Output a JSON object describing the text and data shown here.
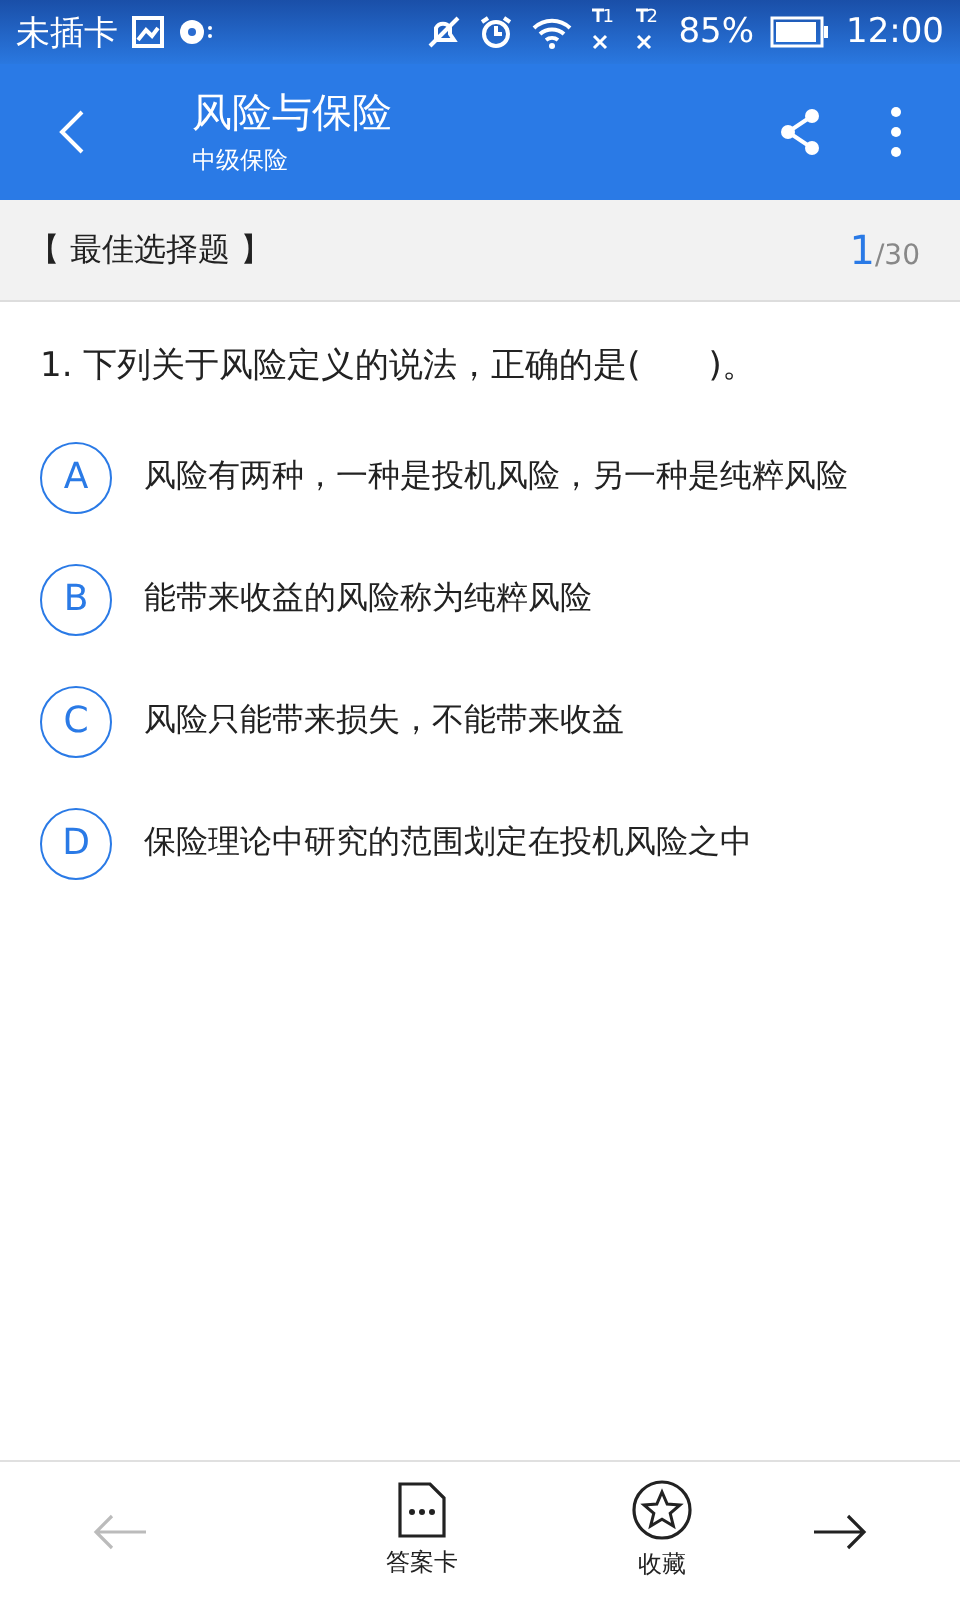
{
  "status_bar": {
    "carrier": "未插卡",
    "sim1": "1",
    "sim2": "2",
    "battery": "85%",
    "time": "12:00"
  },
  "app_bar": {
    "title": "风险与保险",
    "subtitle": "中级保险"
  },
  "section": {
    "type": "【 最佳选择题 】",
    "current": "1",
    "total": "/30"
  },
  "question": {
    "text": "1. 下列关于风险定义的说法，正确的是(　　)。",
    "options": [
      {
        "letter": "A",
        "text": "风险有两种，一种是投机风险，另一种是纯粹风险",
        "selected": false
      },
      {
        "letter": "B",
        "text": "能带来收益的风险称为纯粹风险",
        "selected": false
      },
      {
        "letter": "C",
        "text": "风险只能带来损失，不能带来收益",
        "selected": false
      },
      {
        "letter": "D",
        "text": "保险理论中研究的范围划定在投机风险之中",
        "selected": false
      }
    ]
  },
  "bottom_nav": {
    "previous_disabled": true,
    "answer_card": "答案卡",
    "favorite": "收藏",
    "next_disabled": false
  }
}
